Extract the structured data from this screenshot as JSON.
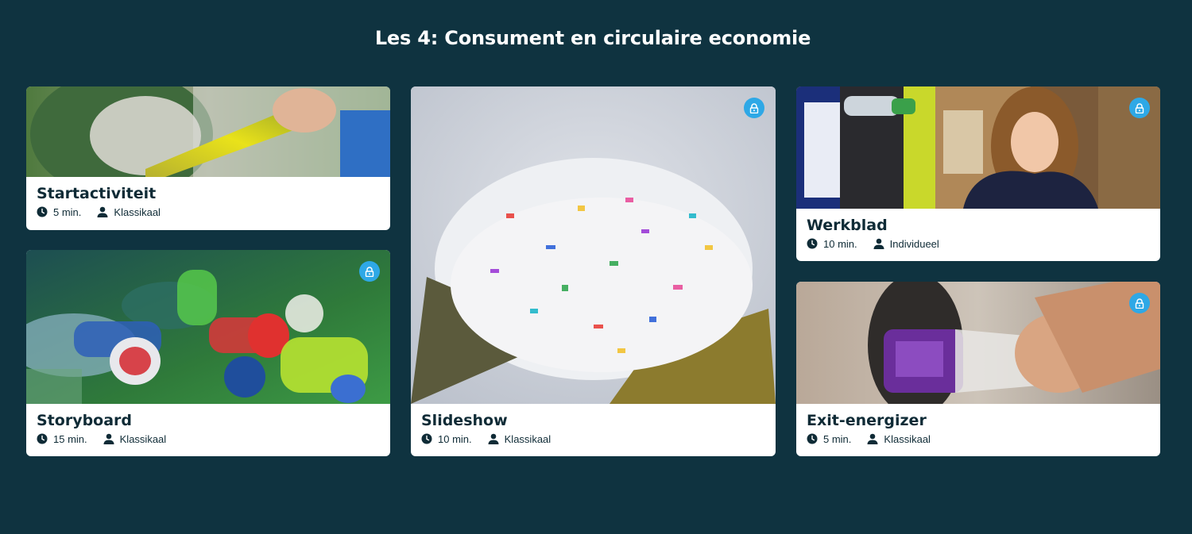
{
  "page": {
    "title": "Les 4: Consument en circulaire economie",
    "background": "#0f3340",
    "accent": "#2ea8e6"
  },
  "activities": [
    {
      "title": "Startactiviteit",
      "duration": "5 min.",
      "mode": "Klassikaal",
      "locked": false,
      "image": "glass-bottle-in-recycling-bin"
    },
    {
      "title": "Storyboard",
      "duration": "15 min.",
      "mode": "Klassikaal",
      "locked": true,
      "image": "plastic-bottles"
    },
    {
      "title": "Slideshow",
      "duration": "10 min.",
      "mode": "Klassikaal",
      "locked": true,
      "image": "shredded-plastic-in-gloved-hand"
    },
    {
      "title": "Werkblad",
      "duration": "10 min.",
      "mode": "Individueel",
      "locked": true,
      "image": "girl-at-bottle-return-machine"
    },
    {
      "title": "Exit-energizer",
      "duration": "5 min.",
      "mode": "Klassikaal",
      "locked": true,
      "image": "bottle-into-return-machine"
    }
  ],
  "icons": {
    "duration": "clock-icon",
    "mode": "person-icon",
    "locked": "lock-icon"
  }
}
